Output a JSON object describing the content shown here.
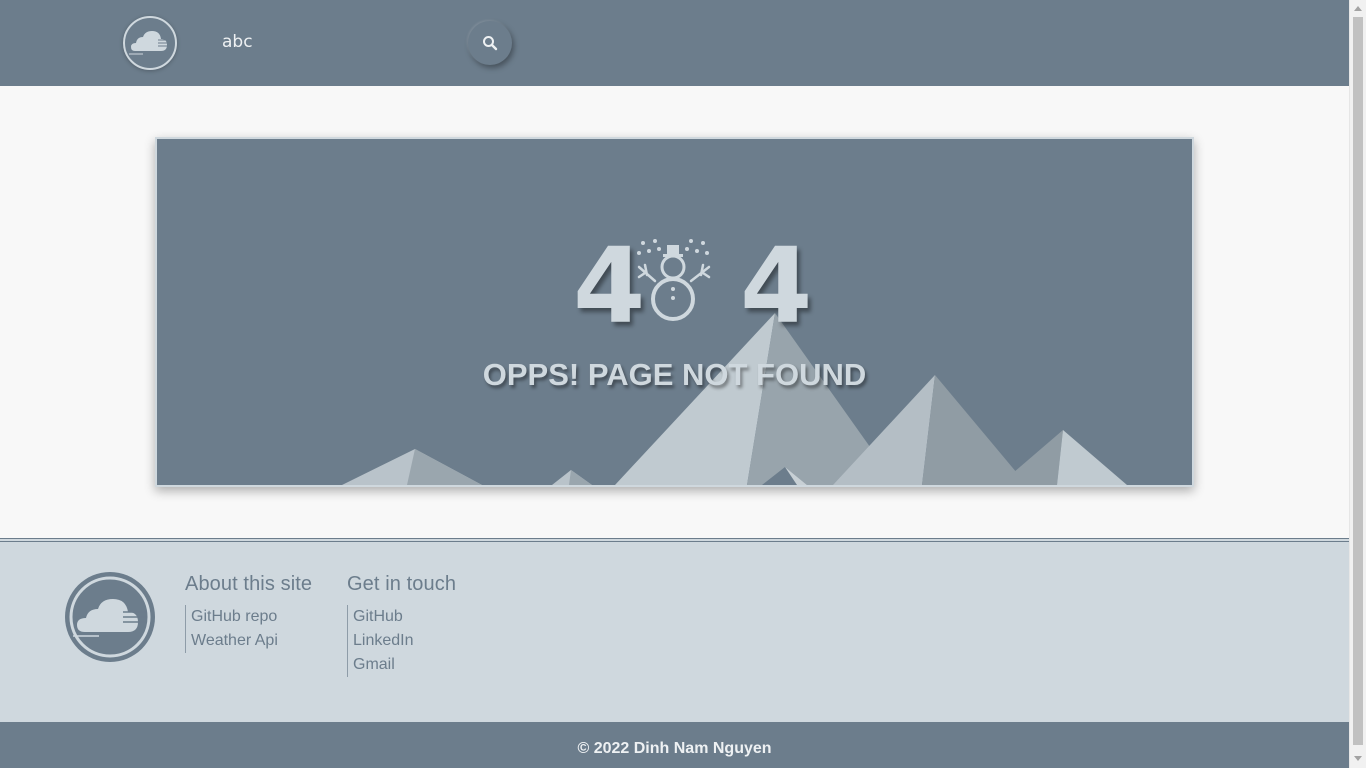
{
  "header": {
    "search_value": "abc"
  },
  "error": {
    "digit_left": "4",
    "digit_right": "4",
    "message": "OPPS! PAGE NOT FOUND"
  },
  "footer": {
    "about": {
      "title": "About this site",
      "links": [
        "GitHub repo",
        "Weather Api"
      ]
    },
    "contact": {
      "title": "Get in touch",
      "links": [
        "GitHub",
        "LinkedIn",
        "Gmail"
      ]
    },
    "copyright": "© 2022 Dinh Nam Nguyen"
  },
  "colors": {
    "primary": "#6c7d8c",
    "light": "#cfd8de",
    "background": "#f8f8f8"
  },
  "icons": {
    "logo": "cloud-wind-icon",
    "search": "search-icon",
    "snowman": "snowman-icon"
  }
}
